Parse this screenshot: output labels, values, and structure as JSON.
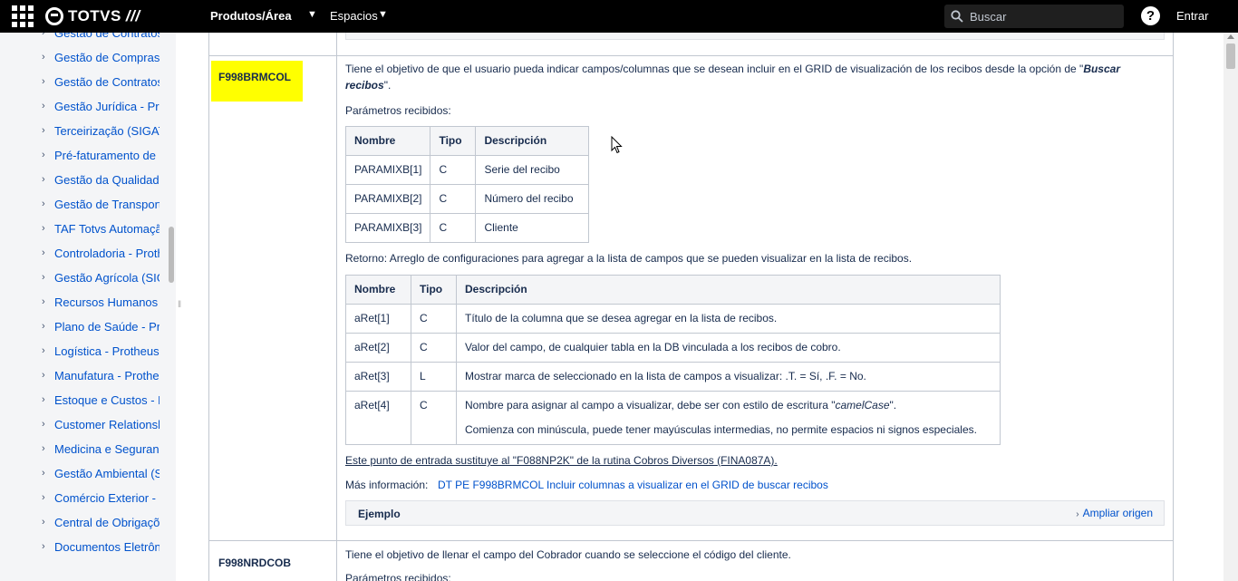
{
  "topbar": {
    "logo_text": "TOTVS",
    "logo_suffix": "///",
    "products_label": "Produtos/Área",
    "spaces_label": "Espacios",
    "search_placeholder": "Buscar",
    "help_label": "?",
    "login_label": "Entrar"
  },
  "sidebar": {
    "items": [
      "Gestão de Contratos",
      "Gestão de Compras -",
      "Gestão de Contratos",
      "Gestão Jurídica - Pro",
      "Terceirização (SIGATE",
      "Pré-faturamento de S",
      "Gestão da Qualidade",
      "Gestão de Transporte",
      "TAF Totvs Automação",
      "Controladoria - Proth",
      "Gestão Agrícola (SIG",
      "Recursos Humanos -",
      "Plano de Saúde - Pro",
      "Logística - Protheus",
      "Manufatura - Prothe",
      "Estoque e Custos - P",
      "Customer Relationsh",
      "Medicina e Seguranç",
      "Gestão Ambiental (SI",
      "Comércio Exterior - P",
      "Central de Obrigaçõe",
      "Documentos Eletrôn"
    ]
  },
  "entry1": {
    "key": "F998BRMCOL",
    "desc_start": "Tiene el objetivo de que el usuario pueda indicar campos/columnas que se desean incluir en el GRID de visualización de los recibos desde la opción de \"",
    "desc_bold_1": "Buscar",
    "desc_bold_2": "recibos",
    "desc_end": "\".",
    "params_label": "Parámetros recibidos:",
    "params_table": {
      "headers": [
        "Nombre",
        "Tipo",
        "Descripción"
      ],
      "rows": [
        [
          "PARAMIXB[1]",
          "C",
          "Serie del recibo"
        ],
        [
          "PARAMIXB[2]",
          "C",
          "Número del recibo"
        ],
        [
          "PARAMIXB[3]",
          "C",
          "Cliente"
        ]
      ]
    },
    "return_label": "Retorno: Arreglo de configuraciones para agregar a la lista de campos que se pueden visualizar en la lista de recibos.",
    "return_table": {
      "headers": [
        "Nombre",
        "Tipo",
        "Descripción"
      ],
      "rows": [
        [
          "aRet[1]",
          "C",
          "Título de la columna que se desea agregar en la lista de recibos."
        ],
        [
          "aRet[2]",
          "C",
          "Valor del campo, de cualquier tabla en la DB vinculada a los recibos de cobro."
        ],
        [
          "aRet[3]",
          "L",
          "Mostrar marca de seleccionado en la lista de campos a visualizar: .T. = Sí, .F. = No."
        ]
      ],
      "row4": {
        "name": "aRet[4]",
        "type": "C",
        "line1_start": "Nombre para asignar al campo a visualizar, debe ser con estilo de escritura \"",
        "line1_italic": "camelCase",
        "line1_end": "\".",
        "line2": "Comienza con minúscula, puede tener mayúsculas intermedias, no permite espacios ni signos especiales."
      }
    },
    "note": "Este punto de entrada sustituye al \"F088NP2K\" de la rutina Cobros Diversos (FINA087A).",
    "more_label": "Más información:",
    "more_link": "DT PE F998BRMCOL Incluir columnas a visualizar en el GRID de buscar recibos",
    "example_title": "Ejemplo",
    "example_expand": "Ampliar origen"
  },
  "entry2": {
    "key": "F998NRDCOB",
    "desc": "Tiene el objetivo de llenar el campo del Cobrador cuando se seleccione el código del cliente.",
    "params_label": "Parámetros recibidos:"
  },
  "colors": {
    "highlight": "#ffff00",
    "link": "#0052cc",
    "topbar": "#000000"
  }
}
